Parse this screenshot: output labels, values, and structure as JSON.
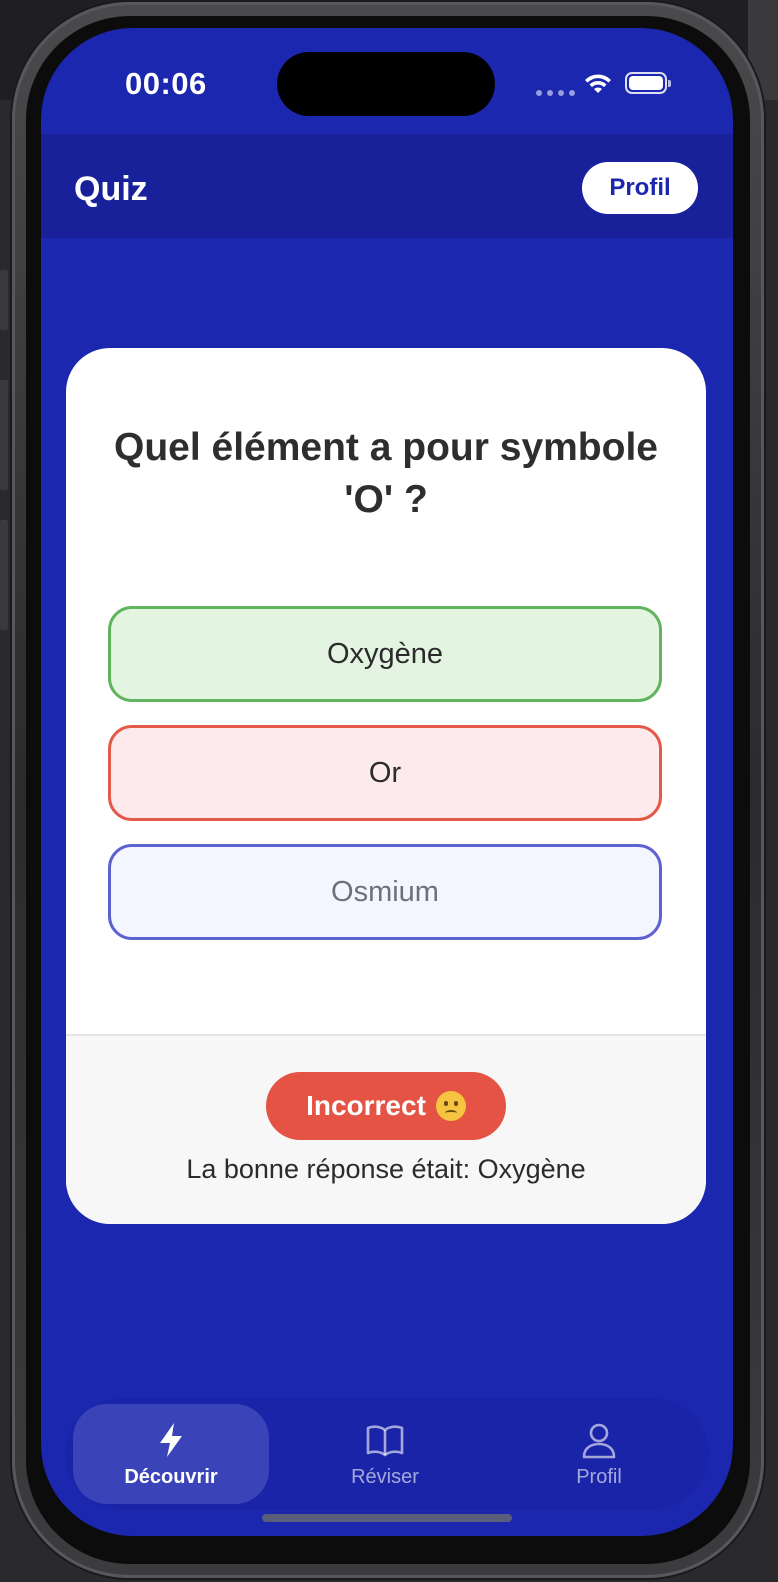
{
  "status_bar": {
    "time": "00:06"
  },
  "header": {
    "title": "Quiz",
    "profile_button": "Profil"
  },
  "quiz": {
    "question": "Quel élément a pour symbole 'O' ?",
    "answers": [
      {
        "label": "Oxygène",
        "state": "correct"
      },
      {
        "label": "Or",
        "state": "incorrect-selected"
      },
      {
        "label": "Osmium",
        "state": "neutral"
      }
    ],
    "feedback": {
      "result": "Incorrect",
      "result_emoji": "confused-face-icon",
      "message": "La bonne réponse était: Oxygène"
    }
  },
  "tab_bar": {
    "items": [
      {
        "label": "Découvrir",
        "icon": "lightning-icon",
        "active": true
      },
      {
        "label": "Réviser",
        "icon": "book-icon",
        "active": false
      },
      {
        "label": "Profil",
        "icon": "person-icon",
        "active": false
      }
    ]
  },
  "colors": {
    "background": "#1c27b0",
    "header": "#18209a",
    "correct_border": "#62b35f",
    "correct_fill": "#e3f4e1",
    "wrong_border": "#e45a4a",
    "wrong_fill": "#fdeaec",
    "neutral_border": "#5d62d0",
    "badge_red": "#e45343"
  }
}
